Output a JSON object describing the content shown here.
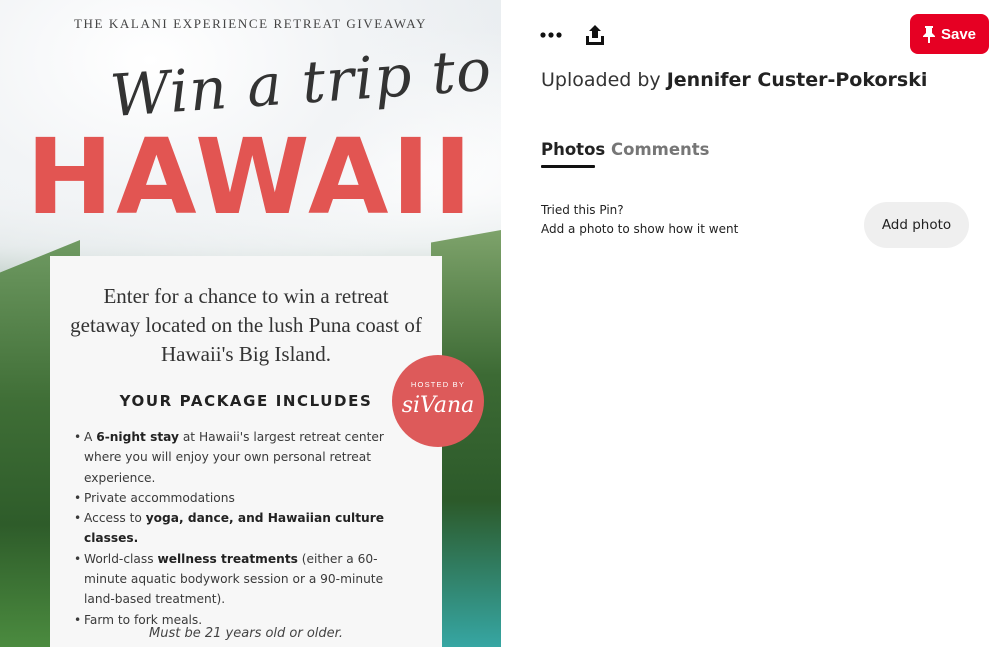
{
  "pin": {
    "top_caption": "THE KALANI EXPERIENCE RETREAT GIVEAWAY",
    "script_line": "Win a trip to",
    "headline": "HAWAII",
    "intro": "Enter for a chance to win a retreat getaway located on the lush Puna coast of Hawaii's Big Island.",
    "package_title": "YOUR PACKAGE INCLUDES",
    "bullets": [
      {
        "pre": "A ",
        "bold": "6-night stay",
        "post": " at Hawaii's largest retreat center where you will enjoy your own personal retreat experience."
      },
      {
        "pre": "Private accommodations",
        "bold": "",
        "post": ""
      },
      {
        "pre": "Access to ",
        "bold": "yoga, dance, and Hawaiian culture classes.",
        "post": ""
      },
      {
        "pre": "World-class ",
        "bold": "wellness treatments",
        "post": " (either a 60-minute aquatic bodywork session or a  90-minute land-based treatment)."
      },
      {
        "pre": "Farm to fork meals.",
        "bold": "",
        "post": ""
      }
    ],
    "age_note": "Must be 21 years old or older.",
    "host_badge": {
      "small": "HOSTED BY",
      "brand": "siVana"
    },
    "colors": {
      "headline": "#e25552",
      "badge": "#dd5a5a"
    }
  },
  "toolbar": {
    "more_icon": "more-dots-icon",
    "share_icon": "share-upload-icon",
    "save_label": "Save",
    "save_icon": "pushpin-icon",
    "save_color": "#e60023"
  },
  "uploader": {
    "prefix": "Uploaded by",
    "name": "Jennifer Custer-Pokorski"
  },
  "tabs": [
    {
      "label": "Photos",
      "active": true
    },
    {
      "label": "Comments",
      "active": false
    }
  ],
  "tried": {
    "title": "Tried this Pin?",
    "subtitle": "Add a photo to show how it went",
    "button_label": "Add photo"
  }
}
